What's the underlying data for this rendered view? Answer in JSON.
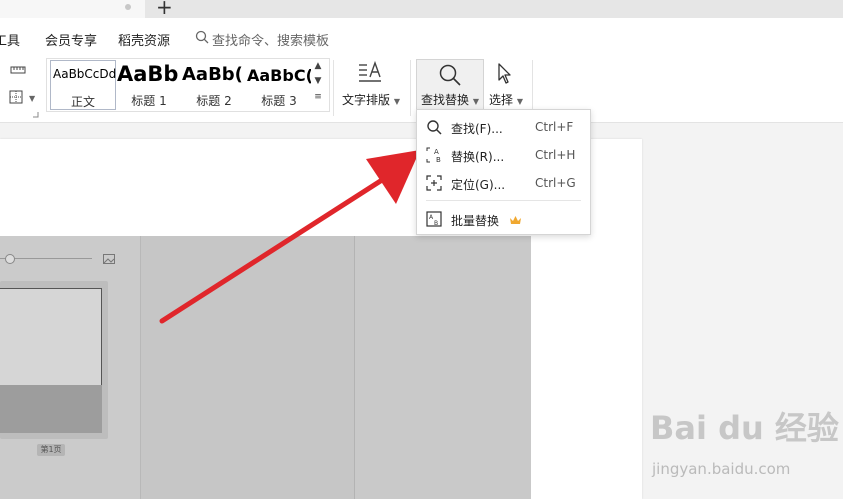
{
  "tabs": {
    "new_tab": "+"
  },
  "menu": {
    "items": [
      "工具",
      "会员专享",
      "稻壳资源"
    ],
    "search_placeholder": "查找命令、搜索模板"
  },
  "ribbon": {
    "styles": [
      {
        "sample": "AaBbCcDd",
        "label": "正文"
      },
      {
        "sample": "AaBb",
        "label": "标题 1"
      },
      {
        "sample": "AaBb(",
        "label": "标题 2"
      },
      {
        "sample": "AaBbC(",
        "label": "标题 3"
      }
    ],
    "text_layout": "文字排版",
    "find_replace": "查找替换",
    "select": "选择"
  },
  "dropdown": {
    "items": [
      {
        "label": "查找(F)...",
        "shortcut": "Ctrl+F",
        "icon": "search-icon"
      },
      {
        "label": "替换(R)...",
        "shortcut": "Ctrl+H",
        "icon": "replace-icon"
      },
      {
        "label": "定位(G)...",
        "shortcut": "Ctrl+G",
        "icon": "locate-icon"
      },
      {
        "label": "批量替换",
        "icon": "batch-replace-icon",
        "badge": "crown-icon"
      }
    ]
  },
  "overlay": {
    "page_label": "第1页"
  },
  "watermark": {
    "logo": "Bai du 经验",
    "url": "jingyan.baidu.com"
  },
  "colors": {
    "arrow": "#e0262b",
    "accent": "#3a7bd5",
    "crown": "#f0a830"
  }
}
